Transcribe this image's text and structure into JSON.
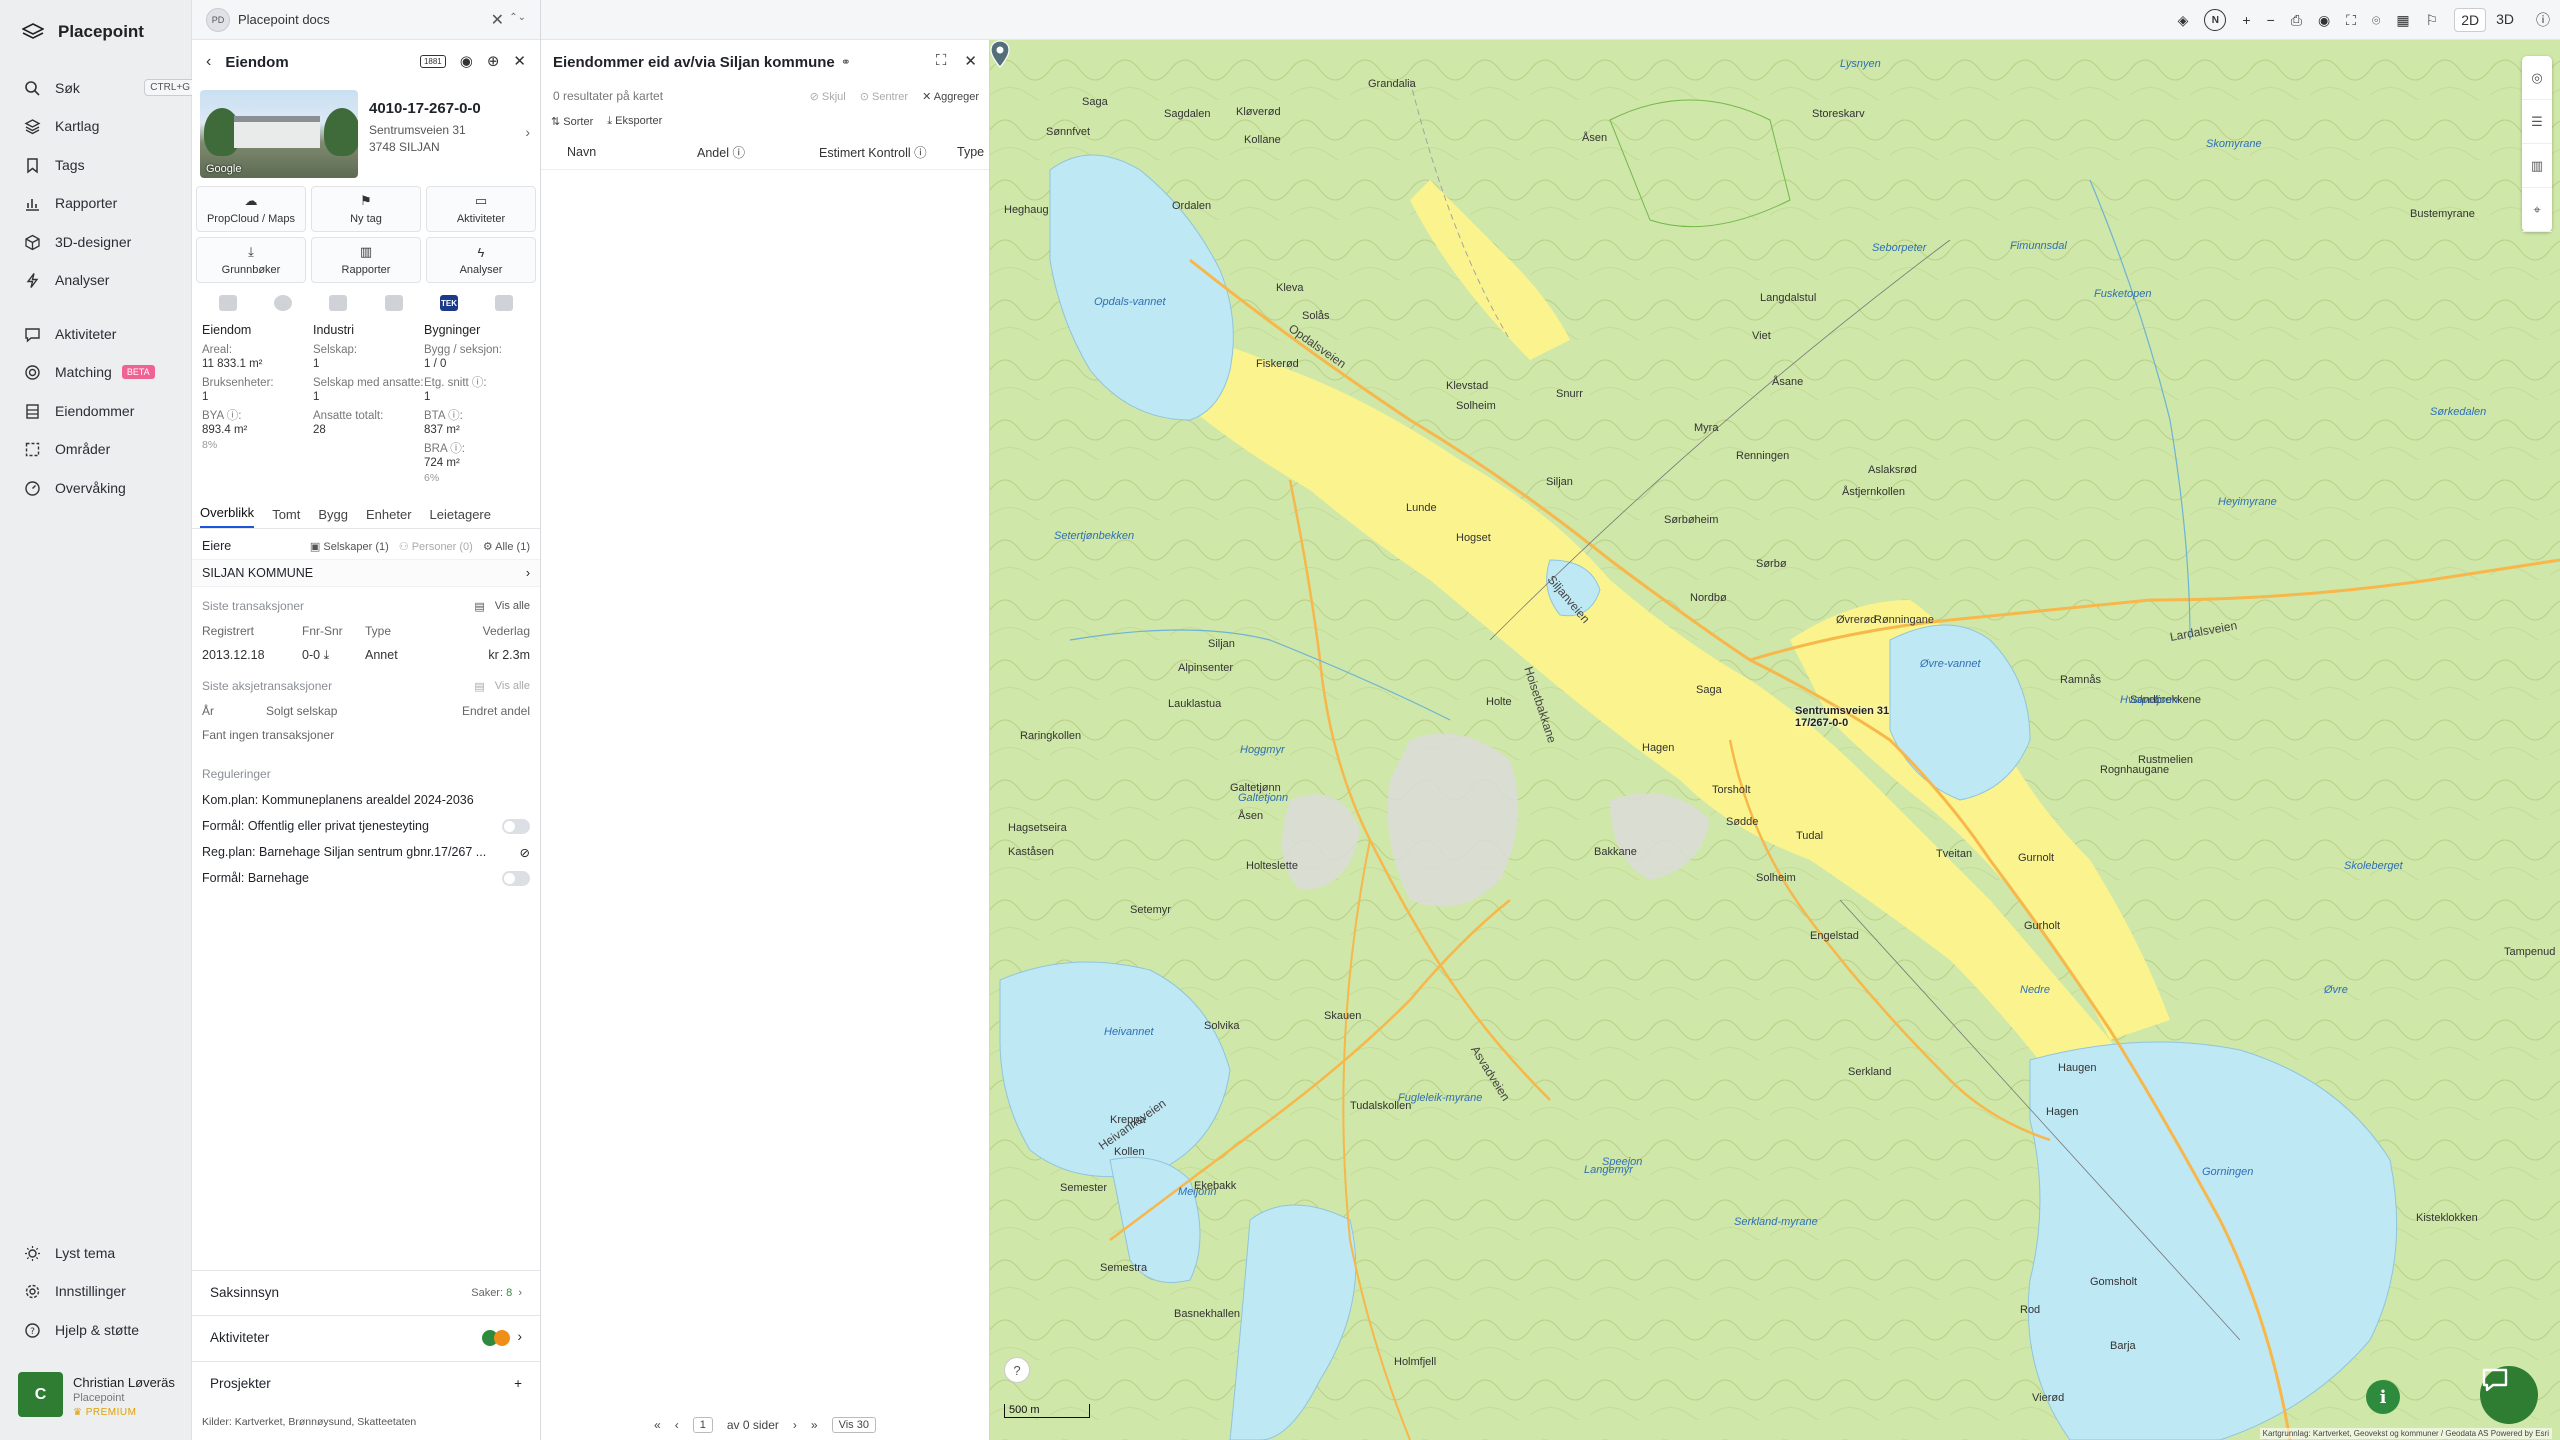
{
  "app": {
    "name": "Placepoint"
  },
  "nav": {
    "items": [
      {
        "label": "Søk",
        "shortcut": "CTRL+G"
      },
      {
        "label": "Kartlag"
      },
      {
        "label": "Tags"
      },
      {
        "label": "Rapporter"
      },
      {
        "label": "3D-designer"
      },
      {
        "label": "Analyser"
      },
      {
        "label": "Aktiviteter"
      },
      {
        "label": "Matching",
        "badge": "BETA"
      },
      {
        "label": "Eiendommer"
      },
      {
        "label": "Områder"
      },
      {
        "label": "Overvåking"
      }
    ],
    "bottom": [
      {
        "label": "Lyst tema"
      },
      {
        "label": "Innstillinger"
      },
      {
        "label": "Hjelp & støtte"
      }
    ],
    "user": {
      "initial": "C",
      "name": "Christian Løveräs",
      "org": "Placepoint",
      "plan": "PREMIUM"
    }
  },
  "doc_tab": {
    "badge": "PD",
    "title": "Placepoint docs"
  },
  "property": {
    "header": "Eiendom",
    "id_badge": "1881",
    "photo_credit": "Google",
    "gnr": "4010-17-267-0-0",
    "street": "Sentrumsveien 31",
    "postal": "3748 SILJAN",
    "actions": [
      "PropCloud / Maps",
      "Ny tag",
      "Aktiviteter",
      "Grunnbøker",
      "Rapporter",
      "Analyser"
    ],
    "tek_label": "TEK",
    "columns": {
      "eiendom": {
        "title": "Eiendom",
        "areal_label": "Areal:",
        "areal": "11 833.1 m²",
        "bruks_label": "Bruksenheter:",
        "bruks": "1",
        "bya_label": "BYA ⓘ:",
        "bya": "893.4 m²",
        "bya_pct": "8%"
      },
      "industri": {
        "title": "Industri",
        "selskap_label": "Selskap:",
        "selskap": "1",
        "med_ansatte_label": "Selskap med ansatte:",
        "med_ansatte": "1",
        "ansatte_label": "Ansatte totalt:",
        "ansatte": "28"
      },
      "bygninger": {
        "title": "Bygninger",
        "bygg_label": "Bygg / seksjon:",
        "bygg": "1 / 0",
        "etg_label": "Etg. snitt ⓘ:",
        "etg": "1",
        "bta_label": "BTA ⓘ:",
        "bta": "837 m²",
        "bra_label": "BRA ⓘ:",
        "bra": "724 m²",
        "bra_pct": "6%"
      }
    },
    "tabs": [
      "Overblikk",
      "Tomt",
      "Bygg",
      "Enheter",
      "Leietagere"
    ],
    "owners": {
      "label": "Eiere",
      "f1": "Selskaper (1)",
      "f2": "Personer (0)",
      "f3": "Alle (1)",
      "owner": "SILJAN KOMMUNE"
    },
    "transactions": {
      "label": "Siste transaksjoner",
      "view_all": "Vis alle",
      "headers": [
        "Registrert",
        "Fnr-Snr",
        "Type",
        "Vederlag"
      ],
      "row": [
        "2013.12.18",
        "0-0",
        "Annet",
        "kr 2.3m"
      ]
    },
    "stock": {
      "label": "Siste aksjetransaksjoner",
      "view_all": "Vis alle",
      "headers": [
        "År",
        "Solgt selskap",
        "Endret andel"
      ],
      "empty": "Fant ingen transaksjoner"
    },
    "regulations": {
      "label": "Reguleringer",
      "items": [
        "Kom.plan: Kommuneplanens arealdel 2024-2036",
        "Formål: Offentlig eller privat tjenesteyting",
        "Reg.plan: Barnehage Siljan sentrum gbnr.17/267 ...",
        "Formål: Barnehage"
      ]
    },
    "bottom": {
      "saksinnsyn": "Saksinnsyn",
      "saker_label": "Saker:",
      "saker": "8",
      "aktiviteter": "Aktiviteter",
      "prosjekter": "Prosjekter"
    },
    "sources": {
      "label": "Kilder:",
      "items": [
        "Kartverket,",
        "Brønnøysund,",
        "Skatteetaten"
      ]
    }
  },
  "list": {
    "title": "Eiendommer eid av/via Siljan kommune",
    "subtitle": "0 resultater på kartet",
    "hide": "Skjul",
    "center": "Sentrer",
    "aggregate": "Aggreger",
    "sort": "Sorter",
    "export": "Eksporter",
    "columns": [
      "Navn",
      "Andel ⓘ",
      "Estimert Kontroll ⓘ",
      "Type"
    ],
    "pager": {
      "page": "1",
      "of": "av 0 sider",
      "per_page": "Vis 30"
    }
  },
  "map": {
    "view_2d": "2D",
    "view_3d": "3D",
    "compass": "N",
    "pin_label_1": "Sentrumsveien 31",
    "pin_label_2": "17/267-0-0",
    "scale": "500 m",
    "attribution": "Kartgrunnlag: Kartverket, Geovekst og kommuner / Geodata AS Powered by Esri",
    "places": [
      "Grandalia",
      "Saga",
      "Sagdalen",
      "Kløverød",
      "Kollane",
      "Åsen",
      "Bustemyrane",
      "Storeskarv",
      "Sønnfvet",
      "Heghaug",
      "Ordalen",
      "Kleva",
      "Solås",
      "Klevstad",
      "Solheim",
      "Snurr",
      "Langdalstul",
      "Viet",
      "Åsane",
      "Fiskerød",
      "Myra",
      "Renningen",
      "Aslaksrød",
      "Åstjernkollen",
      "Lunde",
      "Siljan",
      "Sørbøheim",
      "Sørbø",
      "Hogset",
      "Nordbø",
      "Øvrerød",
      "Rønningane",
      "Siljan",
      "Alpinsenter",
      "Lauklastua",
      "Holte",
      "Saga",
      "Hagen",
      "Ramnås",
      "Sandbrekkene",
      "Rustmelien",
      "Raringkollen",
      "Galtetjønn",
      "Åsen",
      "Torsholt",
      "Sødde",
      "Bakkane",
      "Tudal",
      "Solheim",
      "Tveitan",
      "Gurnolt",
      "Rognhaugane",
      "Hagsetseira",
      "Kaståsen",
      "Holteslette",
      "Setemyr",
      "Skauen",
      "Solvika",
      "Engelstad",
      "Gurholt",
      "Serkland",
      "Tudalskollen",
      "Haugen",
      "Hagen",
      "Kreppa",
      "Kollen",
      "Ekebakk",
      "Semester",
      "Gomsholt",
      "Kisteklokken",
      "Semestra",
      "Basnekhallen",
      "Holmfjell",
      "Rod",
      "Barja",
      "Vierød",
      "Tampenud"
    ],
    "waters": [
      "Opdals-vannet",
      "Setertjønbekken",
      "Hoggmyr",
      "Galtetjonn",
      "Heivannet",
      "Meljonn",
      "Fugleleik-myrane",
      "Langemyr",
      "Serkland-myrane",
      "Speejon",
      "Øvre-vannet",
      "Hvalpetjonn",
      "Skoleberget",
      "Gorningen",
      "Lysnyen",
      "Skomyrane",
      "Seborpeter",
      "Fimunnsdal",
      "Fusketopen",
      "Heyimyrane",
      "Sørkedalen",
      "Nedre",
      "Øvre"
    ],
    "roads": [
      "Opdalsveien",
      "Siljanveien",
      "Hoisetbakkane",
      "Lardalsveien",
      "Heivannsveien",
      "Asvadveien"
    ]
  }
}
